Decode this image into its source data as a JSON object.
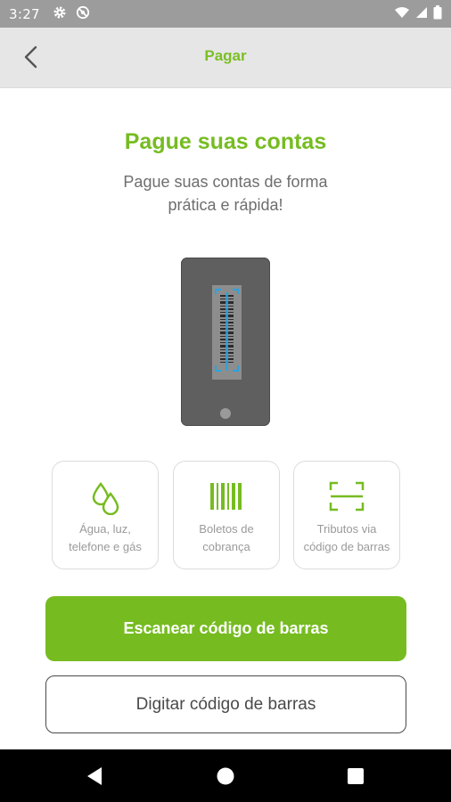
{
  "status_bar": {
    "time": "3:27",
    "icons": [
      "gear-icon",
      "no-sim-icon",
      "wifi-icon",
      "signal-icon",
      "battery-icon"
    ]
  },
  "app_bar": {
    "title": "Pagar",
    "back_icon": "back-arrow-icon"
  },
  "main": {
    "heading": "Pague suas contas",
    "subtitle": "Pague suas contas de forma prática e rápida!",
    "illustration": "phone-barcode-scanner"
  },
  "cards": [
    {
      "icon": "water-drops-icon",
      "line1": "Água, luz,",
      "line2": "telefone e gás"
    },
    {
      "icon": "barcode-icon",
      "line1": "Boletos de",
      "line2": "cobrança"
    },
    {
      "icon": "scan-frame-icon",
      "line1": "Tributos via",
      "line2": "código de barras"
    }
  ],
  "buttons": {
    "scan_label": "Escanear código de barras",
    "type_label": "Digitar código de barras"
  },
  "nav_bar": {
    "back": "nav-back-icon",
    "home": "nav-home-icon",
    "recents": "nav-recents-icon"
  },
  "colors": {
    "accent": "#76bc21",
    "status_bar": "#9c9c9c",
    "app_bar": "#e6e6e6",
    "scanner_blue": "#29a3e0",
    "phone": "#5f5f5f"
  }
}
